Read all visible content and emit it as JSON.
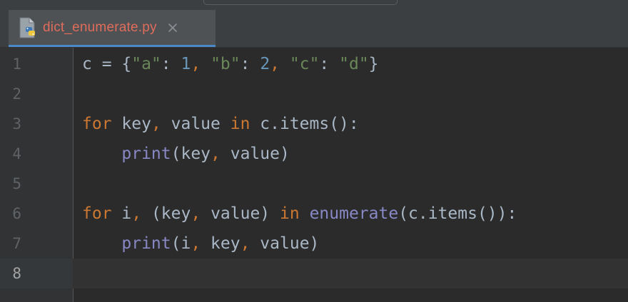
{
  "window": {
    "tab": {
      "filename": "dict_enumerate.py",
      "icon": "python-file-icon",
      "close_icon": "close-icon"
    }
  },
  "colors": {
    "background": "#2b2b2b",
    "gutter": "#313335",
    "keyword": "#cc7832",
    "string": "#6a8759",
    "number": "#6897bb",
    "builtin": "#8888c6",
    "identifier": "#a9b7c6",
    "tab_text": "#e06c5b"
  },
  "editor": {
    "current_line": 8,
    "lines": [
      {
        "number": "1",
        "tokens": [
          {
            "t": "c = {",
            "c": ""
          },
          {
            "t": "\"a\"",
            "c": "str"
          },
          {
            "t": ": ",
            "c": ""
          },
          {
            "t": "1",
            "c": "num"
          },
          {
            "t": ", ",
            "c": "comma"
          },
          {
            "t": "\"b\"",
            "c": "str"
          },
          {
            "t": ": ",
            "c": ""
          },
          {
            "t": "2",
            "c": "num"
          },
          {
            "t": ", ",
            "c": "comma"
          },
          {
            "t": "\"c\"",
            "c": "str"
          },
          {
            "t": ": ",
            "c": ""
          },
          {
            "t": "\"d\"",
            "c": "str"
          },
          {
            "t": "}",
            "c": ""
          }
        ]
      },
      {
        "number": "2",
        "tokens": []
      },
      {
        "number": "3",
        "tokens": [
          {
            "t": "for",
            "c": "kw"
          },
          {
            "t": " key",
            "c": ""
          },
          {
            "t": ",",
            "c": "comma"
          },
          {
            "t": " value ",
            "c": ""
          },
          {
            "t": "in",
            "c": "kw"
          },
          {
            "t": " c.items():",
            "c": ""
          }
        ]
      },
      {
        "number": "4",
        "tokens": [
          {
            "t": "    ",
            "c": ""
          },
          {
            "t": "print",
            "c": "bi"
          },
          {
            "t": "(key",
            "c": ""
          },
          {
            "t": ",",
            "c": "comma"
          },
          {
            "t": " value)",
            "c": ""
          }
        ]
      },
      {
        "number": "5",
        "tokens": []
      },
      {
        "number": "6",
        "tokens": [
          {
            "t": "for",
            "c": "kw"
          },
          {
            "t": " i",
            "c": ""
          },
          {
            "t": ",",
            "c": "comma"
          },
          {
            "t": " (key",
            "c": ""
          },
          {
            "t": ",",
            "c": "comma"
          },
          {
            "t": " value) ",
            "c": ""
          },
          {
            "t": "in",
            "c": "kw"
          },
          {
            "t": " ",
            "c": ""
          },
          {
            "t": "enumerate",
            "c": "bi"
          },
          {
            "t": "(c.items()):",
            "c": ""
          }
        ]
      },
      {
        "number": "7",
        "tokens": [
          {
            "t": "    ",
            "c": ""
          },
          {
            "t": "print",
            "c": "bi"
          },
          {
            "t": "(i",
            "c": ""
          },
          {
            "t": ",",
            "c": "comma"
          },
          {
            "t": " key",
            "c": ""
          },
          {
            "t": ",",
            "c": "comma"
          },
          {
            "t": " value)",
            "c": ""
          }
        ]
      },
      {
        "number": "8",
        "tokens": []
      }
    ]
  }
}
